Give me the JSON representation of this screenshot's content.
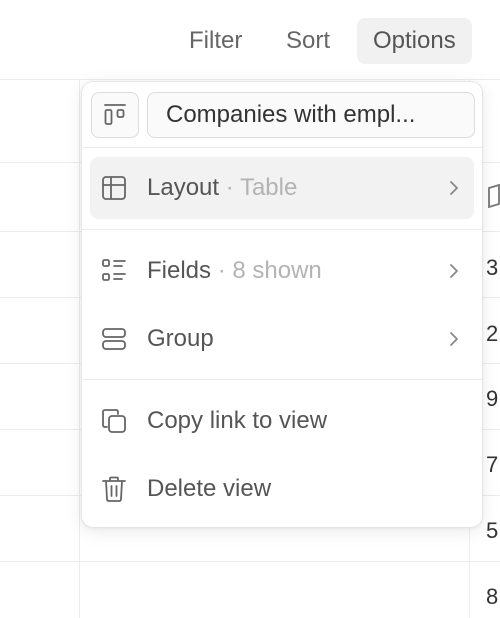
{
  "toolbar": {
    "filter_label": "Filter",
    "sort_label": "Sort",
    "options_label": "Options"
  },
  "table": {
    "partial_values": [
      "3",
      "2",
      "9",
      "7",
      "5",
      "8"
    ]
  },
  "menu": {
    "view_name": "Companies with empl...",
    "items": [
      {
        "label": "Layout",
        "detail": "· Table",
        "icon": "table-icon",
        "has_submenu": true,
        "active": true
      },
      {
        "label": "Fields",
        "detail": "· 8 shown",
        "icon": "list-icon",
        "has_submenu": true,
        "active": false
      },
      {
        "label": "Group",
        "detail": "",
        "icon": "group-icon",
        "has_submenu": true,
        "active": false
      },
      {
        "label": "Copy link to view",
        "detail": "",
        "icon": "copy-icon",
        "has_submenu": false,
        "active": false
      },
      {
        "label": "Delete view",
        "detail": "",
        "icon": "trash-icon",
        "has_submenu": false,
        "active": false
      }
    ]
  }
}
